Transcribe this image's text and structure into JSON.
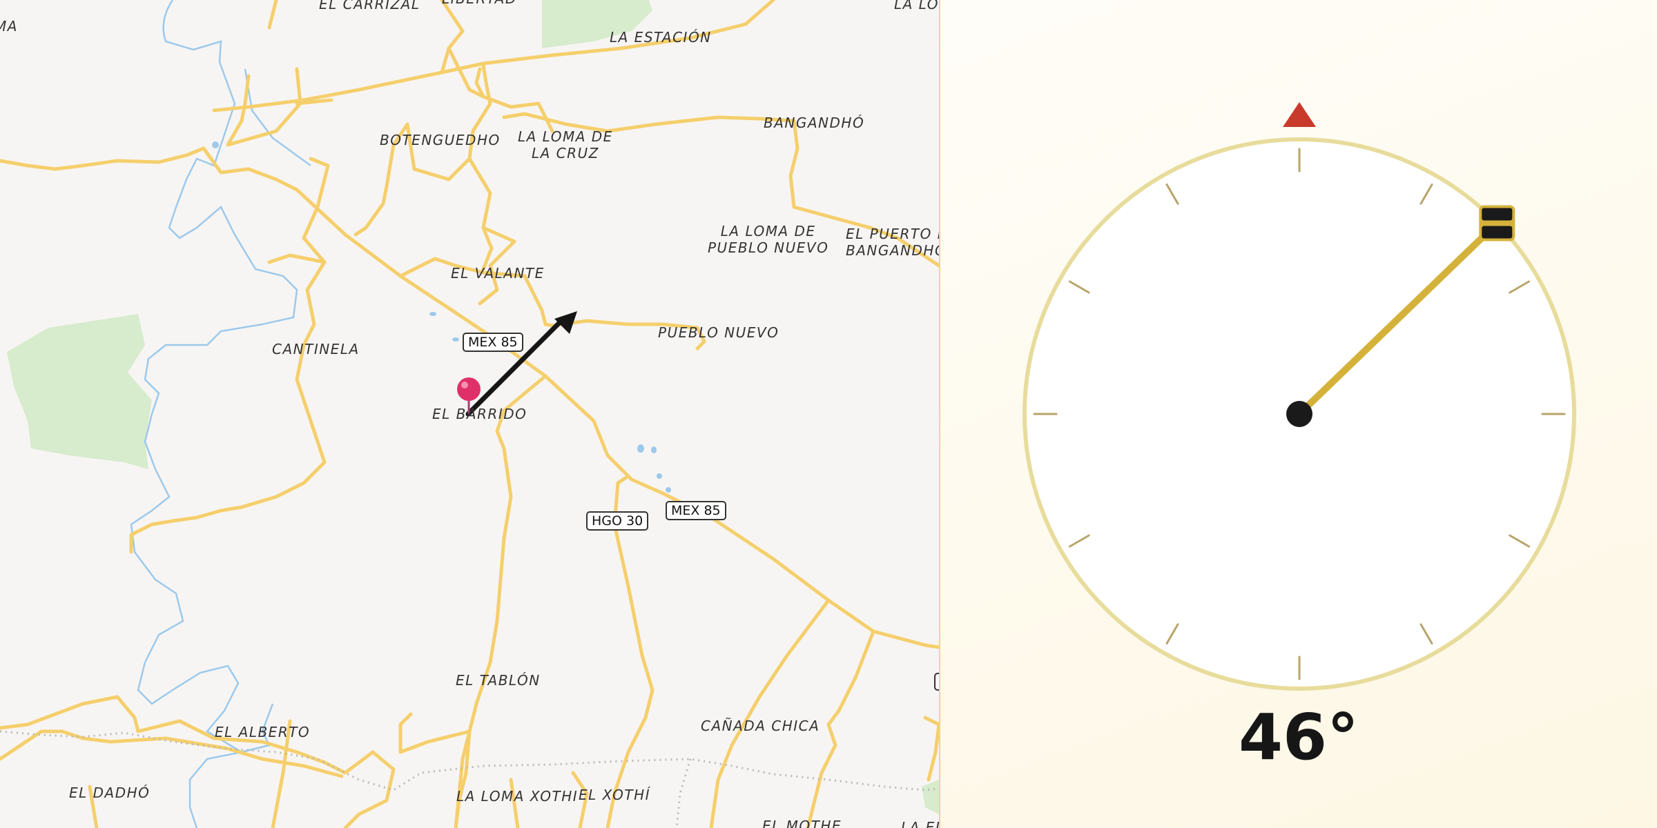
{
  "map": {
    "places": {
      "el_carrizal": "EL CARRIZAL",
      "libertad": "LIBERTAD",
      "la_estacion": "LA ESTACIÓN",
      "la_lo": "LA LO",
      "ma": "MA",
      "botenguedho": "BOTENGUEDHO",
      "la_loma_de_la_cruz_1": "LA LOMA DE",
      "la_loma_de_la_cruz_2": "LA CRUZ",
      "banganho": "BANGANDHÓ",
      "la_loma_pueblo_nuevo_1": "LA LOMA DE",
      "la_loma_pueblo_nuevo_2": "PUEBLO NUEVO",
      "el_puerto_1": "EL PUERTO D",
      "el_puerto_2": "BANGANDHO",
      "el_valante": "EL VALANTE",
      "pueblo_nuevo": "PUEBLO NUEVO",
      "cantinela": "CANTINELA",
      "el_barrido": "EL BARRIDO",
      "el_tablon": "EL TABLÓN",
      "canada_chica": "CAÑADA CHICA",
      "el_alberto": "EL ALBERTO",
      "el_dadho": "EL DADHÓ",
      "la_loma_xothi": "LA LOMA XOTHI",
      "el_xothi": "EL XOTHÍ",
      "el_mothe": "EL MOTHE",
      "la_el": "LA EL"
    },
    "shields": {
      "mex85_a": "MEX 85",
      "mex85_b": "MEX 85",
      "hgo30": "HGO 30"
    },
    "colors": {
      "background": "#f7f5f3",
      "road": "#f5cf6c",
      "water": "#9cc9ec",
      "park": "#d7ebcd",
      "pin": "#e0306a"
    }
  },
  "compass": {
    "heading_text": "46°",
    "heading_degrees": 46,
    "colors": {
      "ring": "#e8dc9c",
      "needle": "#d4b23a",
      "north_marker": "#c83a2c",
      "hub": "#1a1a1a"
    },
    "icons": {
      "north": "north-triangle-icon",
      "handle": "equals-handle-icon"
    }
  }
}
